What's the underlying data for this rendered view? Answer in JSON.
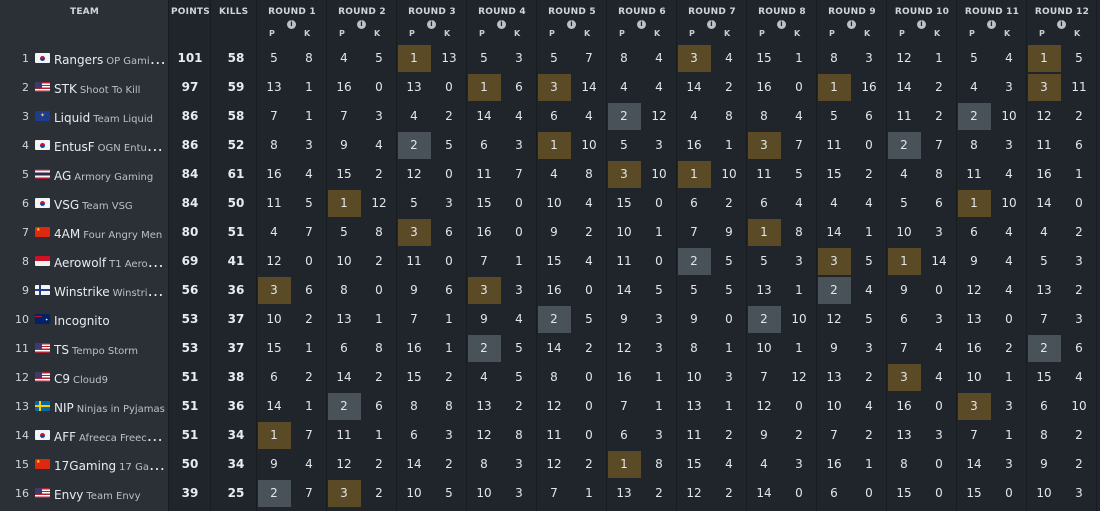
{
  "header": {
    "team_label": "TEAM",
    "points_label": "POINTS",
    "kills_label": "KILLS",
    "place_label": "P",
    "kills_short_label": "K",
    "info_glyph": "i",
    "rounds": [
      "ROUND 1",
      "ROUND 2",
      "ROUND 3",
      "ROUND 4",
      "ROUND 5",
      "ROUND 6",
      "ROUND 7",
      "ROUND 8",
      "ROUND 9",
      "ROUND 10",
      "ROUND 11",
      "ROUND 12"
    ]
  },
  "colors": {
    "gold_highlight": "#5a4a26",
    "grey_highlight": "#4a5259",
    "panel": "#2a3036",
    "background": "#1f252b"
  },
  "teams": [
    {
      "rank": "1",
      "flag": "kr-flag-icon",
      "short": "Rangers",
      "long": "OP Gaming Rangers",
      "points": "101",
      "kills": "58",
      "rounds": [
        [
          "5",
          "8"
        ],
        [
          "4",
          "5"
        ],
        [
          "1",
          "13"
        ],
        [
          "5",
          "3"
        ],
        [
          "5",
          "7"
        ],
        [
          "8",
          "4"
        ],
        [
          "3",
          "4"
        ],
        [
          "15",
          "1"
        ],
        [
          "8",
          "3"
        ],
        [
          "12",
          "1"
        ],
        [
          "5",
          "4"
        ],
        [
          "1",
          "5"
        ]
      ]
    },
    {
      "rank": "2",
      "flag": "us-flag-icon",
      "short": "STK",
      "long": "Shoot To Kill",
      "points": "97",
      "kills": "59",
      "rounds": [
        [
          "13",
          "1"
        ],
        [
          "16",
          "0"
        ],
        [
          "13",
          "0"
        ],
        [
          "1",
          "6"
        ],
        [
          "3",
          "14"
        ],
        [
          "4",
          "4"
        ],
        [
          "14",
          "2"
        ],
        [
          "16",
          "0"
        ],
        [
          "1",
          "16"
        ],
        [
          "14",
          "2"
        ],
        [
          "4",
          "3"
        ],
        [
          "3",
          "11"
        ]
      ]
    },
    {
      "rank": "3",
      "flag": "eu-flag-icon",
      "short": "Liquid",
      "long": "Team Liquid",
      "points": "86",
      "kills": "58",
      "rounds": [
        [
          "7",
          "1"
        ],
        [
          "7",
          "3"
        ],
        [
          "4",
          "2"
        ],
        [
          "14",
          "4"
        ],
        [
          "6",
          "4"
        ],
        [
          "2",
          "12"
        ],
        [
          "4",
          "8"
        ],
        [
          "8",
          "4"
        ],
        [
          "5",
          "6"
        ],
        [
          "11",
          "2"
        ],
        [
          "2",
          "10"
        ],
        [
          "12",
          "2"
        ]
      ]
    },
    {
      "rank": "4",
      "flag": "kr-flag-icon",
      "short": "EntusF",
      "long": "OGN Entus Force",
      "points": "86",
      "kills": "52",
      "rounds": [
        [
          "8",
          "3"
        ],
        [
          "9",
          "4"
        ],
        [
          "2",
          "5"
        ],
        [
          "6",
          "3"
        ],
        [
          "1",
          "10"
        ],
        [
          "5",
          "3"
        ],
        [
          "16",
          "1"
        ],
        [
          "3",
          "7"
        ],
        [
          "11",
          "0"
        ],
        [
          "2",
          "7"
        ],
        [
          "8",
          "3"
        ],
        [
          "11",
          "6"
        ]
      ]
    },
    {
      "rank": "5",
      "flag": "th-flag-icon",
      "short": "AG",
      "long": "Armory Gaming",
      "points": "84",
      "kills": "61",
      "rounds": [
        [
          "16",
          "4"
        ],
        [
          "15",
          "2"
        ],
        [
          "12",
          "0"
        ],
        [
          "11",
          "7"
        ],
        [
          "4",
          "8"
        ],
        [
          "3",
          "10"
        ],
        [
          "1",
          "10"
        ],
        [
          "11",
          "5"
        ],
        [
          "15",
          "2"
        ],
        [
          "4",
          "8"
        ],
        [
          "11",
          "4"
        ],
        [
          "16",
          "1"
        ]
      ]
    },
    {
      "rank": "6",
      "flag": "kr-flag-icon",
      "short": "VSG",
      "long": "Team VSG",
      "points": "84",
      "kills": "50",
      "rounds": [
        [
          "11",
          "5"
        ],
        [
          "1",
          "12"
        ],
        [
          "5",
          "3"
        ],
        [
          "15",
          "0"
        ],
        [
          "10",
          "4"
        ],
        [
          "15",
          "0"
        ],
        [
          "6",
          "2"
        ],
        [
          "6",
          "4"
        ],
        [
          "4",
          "4"
        ],
        [
          "5",
          "6"
        ],
        [
          "1",
          "10"
        ],
        [
          "14",
          "0"
        ]
      ]
    },
    {
      "rank": "7",
      "flag": "cn-flag-icon",
      "short": "4AM",
      "long": "Four Angry Men",
      "points": "80",
      "kills": "51",
      "rounds": [
        [
          "4",
          "7"
        ],
        [
          "5",
          "8"
        ],
        [
          "3",
          "6"
        ],
        [
          "16",
          "0"
        ],
        [
          "9",
          "2"
        ],
        [
          "10",
          "1"
        ],
        [
          "7",
          "9"
        ],
        [
          "1",
          "8"
        ],
        [
          "14",
          "1"
        ],
        [
          "10",
          "3"
        ],
        [
          "6",
          "4"
        ],
        [
          "4",
          "2"
        ]
      ]
    },
    {
      "rank": "8",
      "flag": "id-flag-icon",
      "short": "Aerowolf",
      "long": "T1 Aerowolf",
      "points": "69",
      "kills": "41",
      "rounds": [
        [
          "12",
          "0"
        ],
        [
          "10",
          "2"
        ],
        [
          "11",
          "0"
        ],
        [
          "7",
          "1"
        ],
        [
          "15",
          "4"
        ],
        [
          "11",
          "0"
        ],
        [
          "2",
          "5"
        ],
        [
          "5",
          "3"
        ],
        [
          "3",
          "5"
        ],
        [
          "1",
          "14"
        ],
        [
          "9",
          "4"
        ],
        [
          "5",
          "3"
        ]
      ]
    },
    {
      "rank": "9",
      "flag": "fi-flag-icon",
      "short": "Winstrike",
      "long": "Winstrike Team",
      "points": "56",
      "kills": "36",
      "rounds": [
        [
          "3",
          "6"
        ],
        [
          "8",
          "0"
        ],
        [
          "9",
          "6"
        ],
        [
          "3",
          "3"
        ],
        [
          "16",
          "0"
        ],
        [
          "14",
          "5"
        ],
        [
          "5",
          "5"
        ],
        [
          "13",
          "1"
        ],
        [
          "2",
          "4"
        ],
        [
          "9",
          "0"
        ],
        [
          "12",
          "4"
        ],
        [
          "13",
          "2"
        ]
      ]
    },
    {
      "rank": "10",
      "flag": "au-flag-icon",
      "short": "Incognito",
      "long": "",
      "points": "53",
      "kills": "37",
      "rounds": [
        [
          "10",
          "2"
        ],
        [
          "13",
          "1"
        ],
        [
          "7",
          "1"
        ],
        [
          "9",
          "4"
        ],
        [
          "2",
          "5"
        ],
        [
          "9",
          "3"
        ],
        [
          "9",
          "0"
        ],
        [
          "2",
          "10"
        ],
        [
          "12",
          "5"
        ],
        [
          "6",
          "3"
        ],
        [
          "13",
          "0"
        ],
        [
          "7",
          "3"
        ]
      ]
    },
    {
      "rank": "11",
      "flag": "us-flag-icon",
      "short": "TS",
      "long": "Tempo Storm",
      "points": "53",
      "kills": "37",
      "rounds": [
        [
          "15",
          "1"
        ],
        [
          "6",
          "8"
        ],
        [
          "16",
          "1"
        ],
        [
          "2",
          "5"
        ],
        [
          "14",
          "2"
        ],
        [
          "12",
          "3"
        ],
        [
          "8",
          "1"
        ],
        [
          "10",
          "1"
        ],
        [
          "9",
          "3"
        ],
        [
          "7",
          "4"
        ],
        [
          "16",
          "2"
        ],
        [
          "2",
          "6"
        ]
      ]
    },
    {
      "rank": "12",
      "flag": "us-flag-icon",
      "short": "C9",
      "long": "Cloud9",
      "points": "51",
      "kills": "38",
      "rounds": [
        [
          "6",
          "2"
        ],
        [
          "14",
          "2"
        ],
        [
          "15",
          "2"
        ],
        [
          "4",
          "5"
        ],
        [
          "8",
          "0"
        ],
        [
          "16",
          "1"
        ],
        [
          "10",
          "3"
        ],
        [
          "7",
          "12"
        ],
        [
          "13",
          "2"
        ],
        [
          "3",
          "4"
        ],
        [
          "10",
          "1"
        ],
        [
          "15",
          "4"
        ]
      ]
    },
    {
      "rank": "13",
      "flag": "se-flag-icon",
      "short": "NIP",
      "long": "Ninjas in Pyjamas",
      "points": "51",
      "kills": "36",
      "rounds": [
        [
          "14",
          "1"
        ],
        [
          "2",
          "6"
        ],
        [
          "8",
          "8"
        ],
        [
          "13",
          "2"
        ],
        [
          "12",
          "0"
        ],
        [
          "7",
          "1"
        ],
        [
          "13",
          "1"
        ],
        [
          "12",
          "0"
        ],
        [
          "10",
          "4"
        ],
        [
          "16",
          "0"
        ],
        [
          "3",
          "3"
        ],
        [
          "6",
          "10"
        ]
      ]
    },
    {
      "rank": "14",
      "flag": "kr-flag-icon",
      "short": "AFF",
      "long": "Afreeca Freecs Fox",
      "points": "51",
      "kills": "34",
      "rounds": [
        [
          "1",
          "7"
        ],
        [
          "11",
          "1"
        ],
        [
          "6",
          "3"
        ],
        [
          "12",
          "8"
        ],
        [
          "11",
          "0"
        ],
        [
          "6",
          "3"
        ],
        [
          "11",
          "2"
        ],
        [
          "9",
          "2"
        ],
        [
          "7",
          "2"
        ],
        [
          "13",
          "3"
        ],
        [
          "7",
          "1"
        ],
        [
          "8",
          "2"
        ]
      ]
    },
    {
      "rank": "15",
      "flag": "cn-flag-icon",
      "short": "17Gaming",
      "long": "17 Gaming",
      "points": "50",
      "kills": "34",
      "rounds": [
        [
          "9",
          "4"
        ],
        [
          "12",
          "2"
        ],
        [
          "14",
          "2"
        ],
        [
          "8",
          "3"
        ],
        [
          "12",
          "2"
        ],
        [
          "1",
          "8"
        ],
        [
          "15",
          "4"
        ],
        [
          "4",
          "3"
        ],
        [
          "16",
          "1"
        ],
        [
          "8",
          "0"
        ],
        [
          "14",
          "3"
        ],
        [
          "9",
          "2"
        ]
      ]
    },
    {
      "rank": "16",
      "flag": "us-flag-icon",
      "short": "Envy",
      "long": "Team Envy",
      "points": "39",
      "kills": "25",
      "rounds": [
        [
          "2",
          "7"
        ],
        [
          "3",
          "2"
        ],
        [
          "10",
          "5"
        ],
        [
          "10",
          "3"
        ],
        [
          "7",
          "1"
        ],
        [
          "13",
          "2"
        ],
        [
          "12",
          "2"
        ],
        [
          "14",
          "0"
        ],
        [
          "6",
          "0"
        ],
        [
          "15",
          "0"
        ],
        [
          "15",
          "0"
        ],
        [
          "10",
          "3"
        ]
      ]
    }
  ]
}
